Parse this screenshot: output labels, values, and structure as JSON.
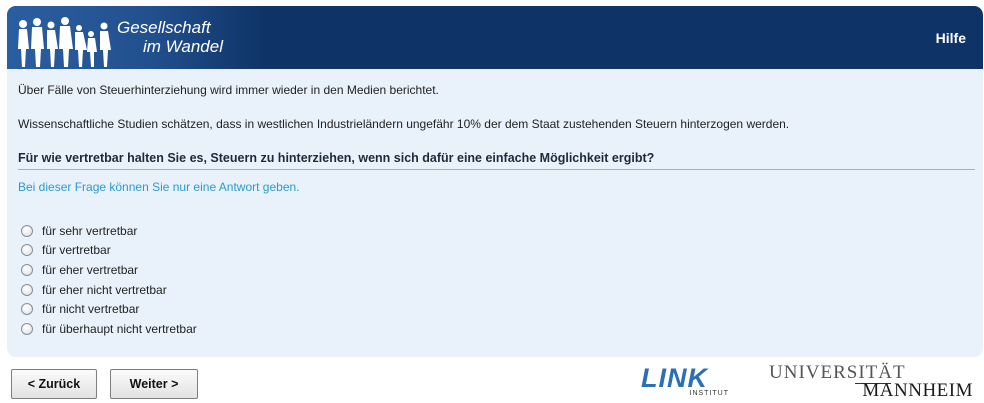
{
  "header": {
    "logo_line1": "Gesellschaft",
    "logo_line2": "im Wandel",
    "help_label": "Hilfe",
    "color": "#0e3366"
  },
  "survey": {
    "intro_text_1": "Über Fälle von Steuerhinterziehung wird immer wieder in den Medien berichtet.",
    "intro_text_2": "Wissenschaftliche Studien schätzen, dass in westlichen Industrieländern ungefähr 10% der dem Staat zustehenden Steuern hinterzogen werden.",
    "question": "Für wie vertretbar halten Sie es, Steuern zu hinterziehen, wenn sich dafür eine einfache Möglichkeit ergibt?",
    "hint": "Bei dieser Frage können Sie nur eine Antwort geben.",
    "options": [
      {
        "label": "für sehr vertretbar"
      },
      {
        "label": "für vertretbar"
      },
      {
        "label": "für eher vertretbar"
      },
      {
        "label": "für eher nicht vertretbar"
      },
      {
        "label": "für nicht vertretbar"
      },
      {
        "label": "für überhaupt nicht vertretbar"
      }
    ]
  },
  "navigation": {
    "back_label": "< Zurück",
    "next_label": "Weiter >"
  },
  "footer": {
    "link_logo": "LINK",
    "link_sub": "INSTITUT",
    "uni_line1": "UNIVERSITÄT",
    "uni_line2": "MANNHEIM"
  }
}
